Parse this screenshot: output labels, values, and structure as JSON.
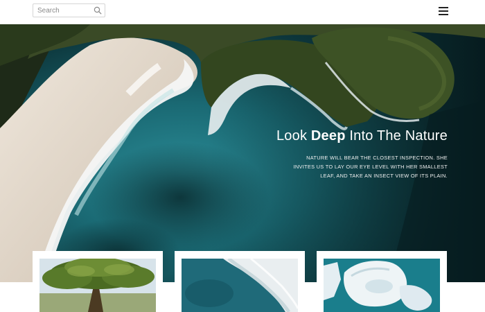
{
  "header": {
    "search_placeholder": "Search",
    "search_icon": "search-icon",
    "menu_icon": "hamburger-menu-icon"
  },
  "hero": {
    "title_pre": "Look ",
    "title_bold": "Deep",
    "title_post": " Into The Nature",
    "description": "NATURE WILL BEAR THE CLOSEST INSPECTION. SHE INVITES US TO LAY OUR EYE LEVEL WITH HER SMALLEST LEAF, AND TAKE AN INSECT VIEW OF ITS PLAIN.",
    "background": "aerial-coastline-photo"
  },
  "cards": [
    {
      "image": "tree-photo"
    },
    {
      "image": "ocean-wave-photo"
    },
    {
      "image": "iceberg-photo"
    }
  ],
  "colors": {
    "sea": "#1b6670",
    "sand": "#e4dcd1",
    "forest": "#2f3b1f",
    "text": "#ffffff"
  }
}
